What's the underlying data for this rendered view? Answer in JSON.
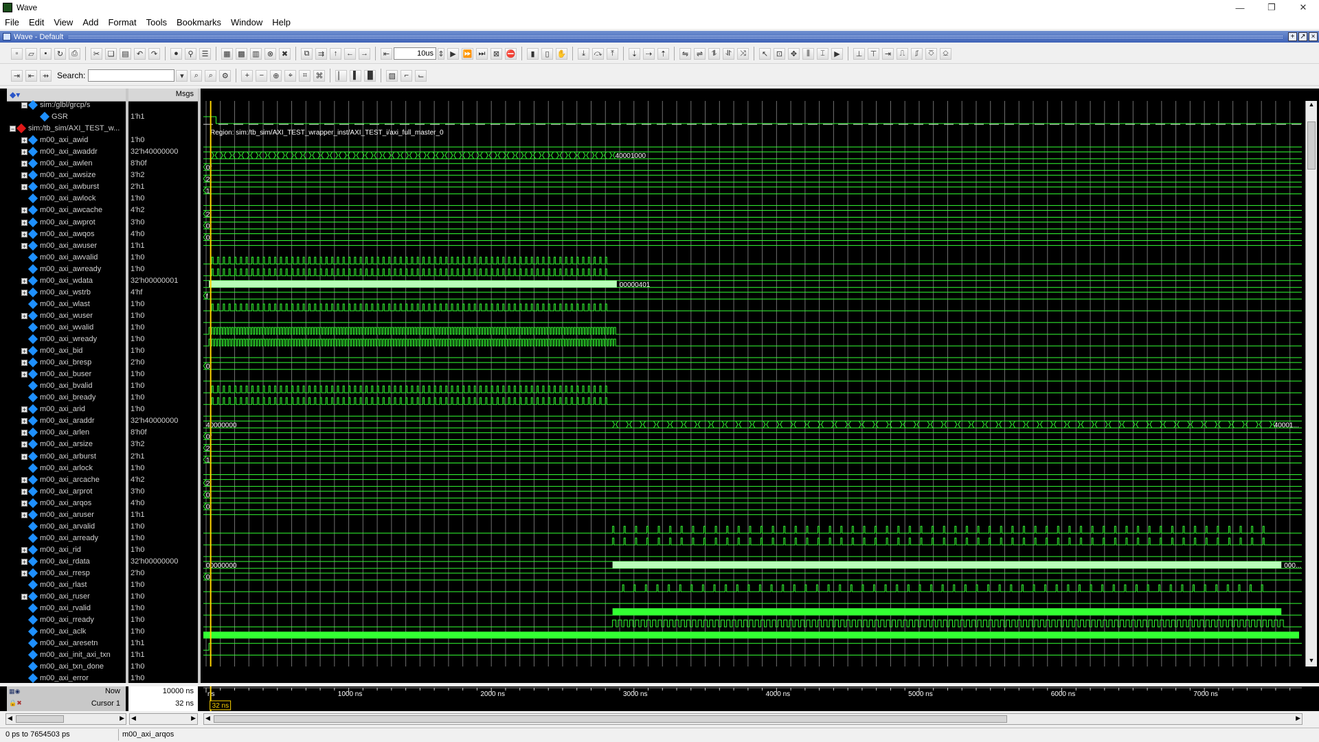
{
  "window": {
    "title": "Wave",
    "controls": [
      "—",
      "❐",
      "✕"
    ]
  },
  "menu": [
    "File",
    "Edit",
    "View",
    "Add",
    "Format",
    "Tools",
    "Bookmarks",
    "Window",
    "Help"
  ],
  "pane": {
    "title": "Wave - Default"
  },
  "toolbar": {
    "time_step": "10us",
    "search_label": "Search:",
    "search_value": ""
  },
  "columns": {
    "msgs": "Msgs"
  },
  "signals": [
    {
      "name": "sim:/glbl/grcp/s",
      "value": "",
      "indent": 1,
      "expand": "-",
      "icon": "blue",
      "wave": "hidden"
    },
    {
      "name": "GSR",
      "value": "1'h1",
      "indent": 2,
      "expand": "",
      "icon": "blue",
      "wave": "bit_fall"
    },
    {
      "name": "sim:/tb_sim/AXI_TEST_w...",
      "value": "",
      "indent": 0,
      "expand": "-",
      "icon": "red",
      "wave": "region",
      "region": "Region: sim:/tb_sim/AXI_TEST_wrapper_inst/AXI_TEST_i/axi_full_master_0"
    },
    {
      "name": "m00_axi_awid",
      "value": "1'h0",
      "indent": 1,
      "expand": "+",
      "icon": "blue",
      "wave": "flat"
    },
    {
      "name": "m00_axi_awaddr",
      "value": "32'h40000000",
      "indent": 1,
      "expand": "+",
      "icon": "blue",
      "wave": "bus_w",
      "end_label": "40001000"
    },
    {
      "name": "m00_axi_awlen",
      "value": "8'h0f",
      "indent": 1,
      "expand": "+",
      "icon": "blue",
      "wave": "bus_s",
      "label": "0f"
    },
    {
      "name": "m00_axi_awsize",
      "value": "3'h2",
      "indent": 1,
      "expand": "+",
      "icon": "blue",
      "wave": "bus_s",
      "label": "2"
    },
    {
      "name": "m00_axi_awburst",
      "value": "2'h1",
      "indent": 1,
      "expand": "+",
      "icon": "blue",
      "wave": "bus_s",
      "label": "1"
    },
    {
      "name": "m00_axi_awlock",
      "value": "1'h0",
      "indent": 1,
      "expand": "",
      "icon": "blue",
      "wave": "flat"
    },
    {
      "name": "m00_axi_awcache",
      "value": "4'h2",
      "indent": 1,
      "expand": "+",
      "icon": "blue",
      "wave": "bus_s",
      "label": "2"
    },
    {
      "name": "m00_axi_awprot",
      "value": "3'h0",
      "indent": 1,
      "expand": "+",
      "icon": "blue",
      "wave": "bus_s",
      "label": "0"
    },
    {
      "name": "m00_axi_awqos",
      "value": "4'h0",
      "indent": 1,
      "expand": "+",
      "icon": "blue",
      "wave": "bus_s",
      "label": "0"
    },
    {
      "name": "m00_axi_awuser",
      "value": "1'h1",
      "indent": 1,
      "expand": "+",
      "icon": "blue",
      "wave": "flat_high"
    },
    {
      "name": "m00_axi_awvalid",
      "value": "1'h0",
      "indent": 1,
      "expand": "",
      "icon": "blue",
      "wave": "pulse_w"
    },
    {
      "name": "m00_axi_awready",
      "value": "1'h0",
      "indent": 1,
      "expand": "",
      "icon": "blue",
      "wave": "pulse_w"
    },
    {
      "name": "m00_axi_wdata",
      "value": "32'h00000001",
      "indent": 1,
      "expand": "+",
      "icon": "blue",
      "wave": "bus_dense_w",
      "end_label": "00000401"
    },
    {
      "name": "m00_axi_wstrb",
      "value": "4'hf",
      "indent": 1,
      "expand": "+",
      "icon": "blue",
      "wave": "bus_s",
      "label": "f"
    },
    {
      "name": "m00_axi_wlast",
      "value": "1'h0",
      "indent": 1,
      "expand": "",
      "icon": "blue",
      "wave": "pulse_w"
    },
    {
      "name": "m00_axi_wuser",
      "value": "1'h0",
      "indent": 1,
      "expand": "+",
      "icon": "blue",
      "wave": "flat"
    },
    {
      "name": "m00_axi_wvalid",
      "value": "1'h0",
      "indent": 1,
      "expand": "",
      "icon": "blue",
      "wave": "toggle_w"
    },
    {
      "name": "m00_axi_wready",
      "value": "1'h0",
      "indent": 1,
      "expand": "",
      "icon": "blue",
      "wave": "toggle_w"
    },
    {
      "name": "m00_axi_bid",
      "value": "1'h0",
      "indent": 1,
      "expand": "+",
      "icon": "blue",
      "wave": "flat"
    },
    {
      "name": "m00_axi_bresp",
      "value": "2'h0",
      "indent": 1,
      "expand": "+",
      "icon": "blue",
      "wave": "bus_s",
      "label": "0"
    },
    {
      "name": "m00_axi_buser",
      "value": "1'h0",
      "indent": 1,
      "expand": "+",
      "icon": "blue",
      "wave": "flat"
    },
    {
      "name": "m00_axi_bvalid",
      "value": "1'h0",
      "indent": 1,
      "expand": "",
      "icon": "blue",
      "wave": "pulse_w"
    },
    {
      "name": "m00_axi_bready",
      "value": "1'h0",
      "indent": 1,
      "expand": "",
      "icon": "blue",
      "wave": "pulse_w"
    },
    {
      "name": "m00_axi_arid",
      "value": "1'h0",
      "indent": 1,
      "expand": "+",
      "icon": "blue",
      "wave": "flat"
    },
    {
      "name": "m00_axi_araddr",
      "value": "32'h40000000",
      "indent": 1,
      "expand": "+",
      "icon": "blue",
      "wave": "bus_r",
      "label": "40000000",
      "end_label": "40001..."
    },
    {
      "name": "m00_axi_arlen",
      "value": "8'h0f",
      "indent": 1,
      "expand": "+",
      "icon": "blue",
      "wave": "bus_s",
      "label": "0f"
    },
    {
      "name": "m00_axi_arsize",
      "value": "3'h2",
      "indent": 1,
      "expand": "+",
      "icon": "blue",
      "wave": "bus_s",
      "label": "2"
    },
    {
      "name": "m00_axi_arburst",
      "value": "2'h1",
      "indent": 1,
      "expand": "+",
      "icon": "blue",
      "wave": "bus_s",
      "label": "1"
    },
    {
      "name": "m00_axi_arlock",
      "value": "1'h0",
      "indent": 1,
      "expand": "",
      "icon": "blue",
      "wave": "flat"
    },
    {
      "name": "m00_axi_arcache",
      "value": "4'h2",
      "indent": 1,
      "expand": "+",
      "icon": "blue",
      "wave": "bus_s",
      "label": "2"
    },
    {
      "name": "m00_axi_arprot",
      "value": "3'h0",
      "indent": 1,
      "expand": "+",
      "icon": "blue",
      "wave": "bus_s",
      "label": "0"
    },
    {
      "name": "m00_axi_arqos",
      "value": "4'h0",
      "indent": 1,
      "expand": "+",
      "icon": "blue",
      "wave": "bus_s",
      "label": "0"
    },
    {
      "name": "m00_axi_aruser",
      "value": "1'h1",
      "indent": 1,
      "expand": "+",
      "icon": "blue",
      "wave": "flat_high"
    },
    {
      "name": "m00_axi_arvalid",
      "value": "1'h0",
      "indent": 1,
      "expand": "",
      "icon": "blue",
      "wave": "pulse_r"
    },
    {
      "name": "m00_axi_arready",
      "value": "1'h0",
      "indent": 1,
      "expand": "",
      "icon": "blue",
      "wave": "pulse_r"
    },
    {
      "name": "m00_axi_rid",
      "value": "1'h0",
      "indent": 1,
      "expand": "+",
      "icon": "blue",
      "wave": "flat"
    },
    {
      "name": "m00_axi_rdata",
      "value": "32'h00000000",
      "indent": 1,
      "expand": "+",
      "icon": "blue",
      "wave": "bus_dense_r",
      "label": "00000000",
      "end_label": "000..."
    },
    {
      "name": "m00_axi_rresp",
      "value": "2'h0",
      "indent": 1,
      "expand": "+",
      "icon": "blue",
      "wave": "bus_s",
      "label": "0"
    },
    {
      "name": "m00_axi_rlast",
      "value": "1'h0",
      "indent": 1,
      "expand": "",
      "icon": "blue",
      "wave": "pulse_rl"
    },
    {
      "name": "m00_axi_ruser",
      "value": "1'h0",
      "indent": 1,
      "expand": "+",
      "icon": "blue",
      "wave": "flat"
    },
    {
      "name": "m00_axi_rvalid",
      "value": "1'h0",
      "indent": 1,
      "expand": "",
      "icon": "blue",
      "wave": "block_r"
    },
    {
      "name": "m00_axi_rready",
      "value": "1'h0",
      "indent": 1,
      "expand": "",
      "icon": "blue",
      "wave": "toggle_r"
    },
    {
      "name": "m00_axi_aclk",
      "value": "1'h0",
      "indent": 1,
      "expand": "",
      "icon": "blue",
      "wave": "clock"
    },
    {
      "name": "m00_axi_aresetn",
      "value": "1'h1",
      "indent": 1,
      "expand": "",
      "icon": "blue",
      "wave": "reset"
    },
    {
      "name": "m00_axi_init_axi_txn",
      "value": "1'h1",
      "indent": 1,
      "expand": "",
      "icon": "blue",
      "wave": "flat_high"
    },
    {
      "name": "m00_axi_txn_done",
      "value": "1'h0",
      "indent": 1,
      "expand": "",
      "icon": "blue",
      "wave": "flat"
    },
    {
      "name": "m00_axi_error",
      "value": "1'h0",
      "indent": 1,
      "expand": "",
      "icon": "blue",
      "wave": "late_rise"
    }
  ],
  "footer": {
    "now_label": "Now",
    "now_value": "10000 ns",
    "cursor_label": "Cursor 1",
    "cursor_value": "32 ns",
    "cursor_marker": "32 ns"
  },
  "timeline": {
    "ticks": [
      {
        "t": 0,
        "label": "ns"
      },
      {
        "t": 1000,
        "label": "1000 ns"
      },
      {
        "t": 2000,
        "label": "2000 ns"
      },
      {
        "t": 3000,
        "label": "3000 ns"
      },
      {
        "t": 4000,
        "label": "4000 ns"
      },
      {
        "t": 5000,
        "label": "5000 ns"
      },
      {
        "t": 6000,
        "label": "6000 ns"
      },
      {
        "t": 7000,
        "label": "7000 ns"
      }
    ],
    "visible_end_ns": 7654.5,
    "cursor_ns": 32
  },
  "status": {
    "range": "0 ps to 7654503 ps",
    "selected": "m00_axi_arqos"
  },
  "colors": {
    "wave": "#33ff33",
    "bus_dense": "#b8ffb8",
    "grid": "#6f6f6f",
    "cursor": "#ffd400",
    "label": "#ffffff"
  }
}
